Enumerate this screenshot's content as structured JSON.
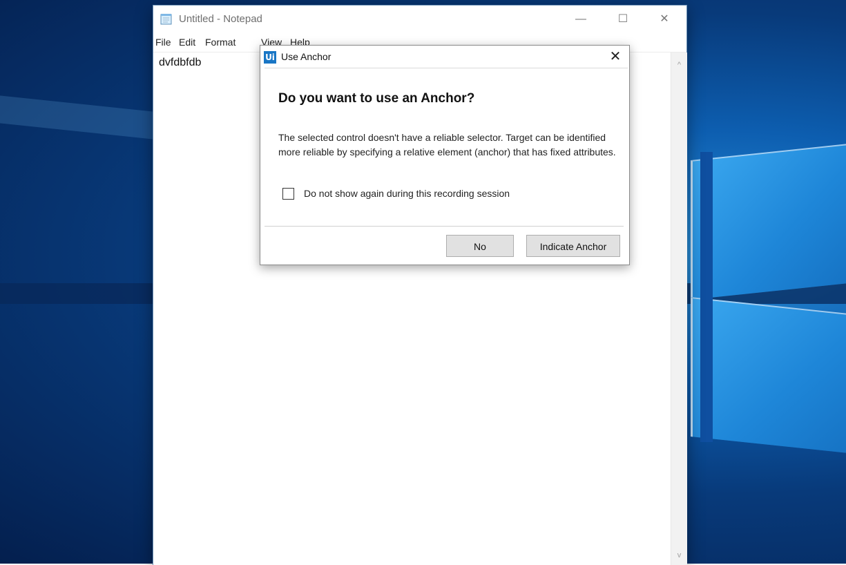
{
  "notepad": {
    "title": "Untitled - Notepad",
    "menu": [
      "File",
      "Edit",
      "Format",
      "View",
      "Help"
    ],
    "content": "dvfdbfdb",
    "caption_buttons": {
      "minimize": "—",
      "maximize": "☐",
      "close": "✕"
    },
    "scroll_up": "^",
    "scroll_down": "v"
  },
  "dialog": {
    "logo": "Ui",
    "title": "Use Anchor",
    "close": "✕",
    "heading": "Do you want to use an Anchor?",
    "message": "The selected control doesn't have a reliable selector. Target can be identified more reliable by specifying a relative element (anchor) that has fixed attributes.",
    "checkbox_label": "Do not show again during this recording session",
    "checkbox_checked": false,
    "buttons": {
      "no": "No",
      "indicate": "Indicate Anchor"
    }
  },
  "colors": {
    "accent": "#1976c5",
    "wallpaper": "#0a4a96"
  }
}
